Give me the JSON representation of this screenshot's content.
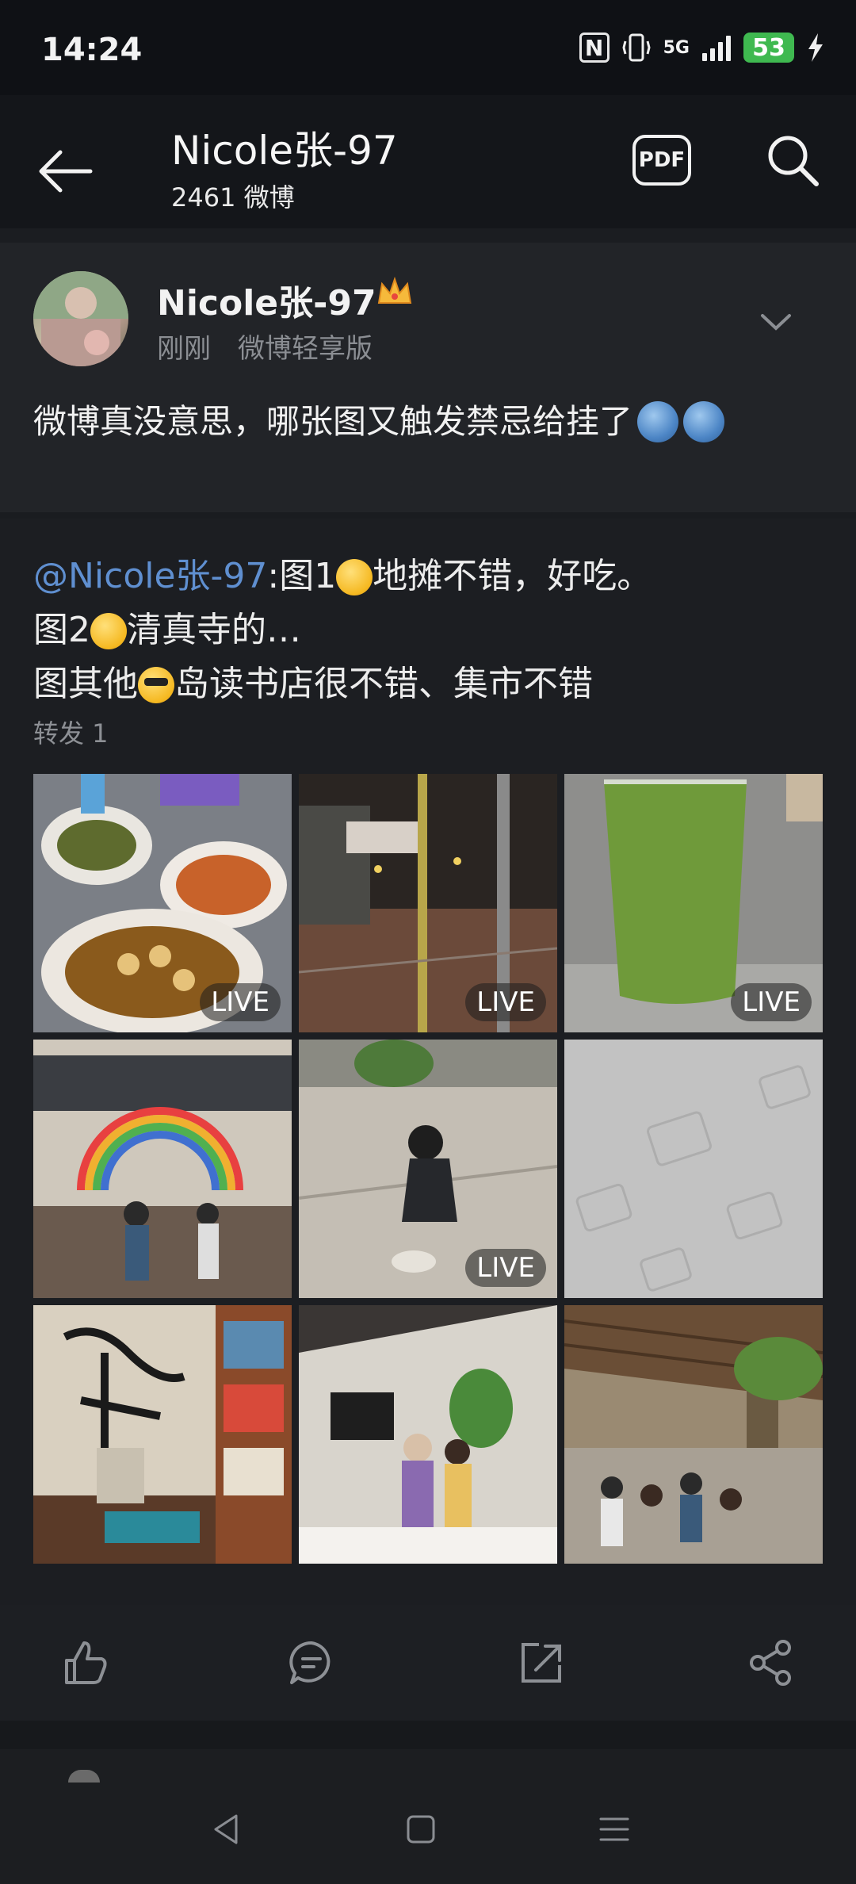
{
  "status_bar": {
    "time": "14:24",
    "battery": "53",
    "network": "5G"
  },
  "nav": {
    "title": "Nicole张-97",
    "subtitle": "2461 微博",
    "pdf_label": "PDF"
  },
  "post": {
    "author": "Nicole张-97",
    "time": "刚刚",
    "source": "微博轻享版",
    "text": "微博真没意思，哪张图又触发禁忌给挂了"
  },
  "retweet": {
    "mention": "@Nicole张-97",
    "line1_a": ":图1",
    "line1_b": "地摊不错，好吃。",
    "line2_a": "图2",
    "line2_b": "清真寺的…",
    "line3_a": "图其他",
    "line3_b": "岛读书店很不错、集市不错",
    "repost_count": "转发 1",
    "live_label": "LIVE",
    "images": [
      {
        "subject": "street-food-dishes",
        "live": true
      },
      {
        "subject": "night-street",
        "live": true
      },
      {
        "subject": "green-drink",
        "live": true
      },
      {
        "subject": "market-hall-rainbow",
        "live": false
      },
      {
        "subject": "girl-petting-cat",
        "live": true
      },
      {
        "subject": "blocked-image-placeholder",
        "live": false
      },
      {
        "subject": "bookstore-calligraphy",
        "live": false
      },
      {
        "subject": "cafe-interior",
        "live": false
      },
      {
        "subject": "outdoor-market-crowd",
        "live": false
      }
    ]
  },
  "actions": [
    "like-icon",
    "comment-icon",
    "repost-icon",
    "share-icon"
  ],
  "system_nav": [
    "back-icon",
    "home-icon",
    "menu-icon"
  ]
}
